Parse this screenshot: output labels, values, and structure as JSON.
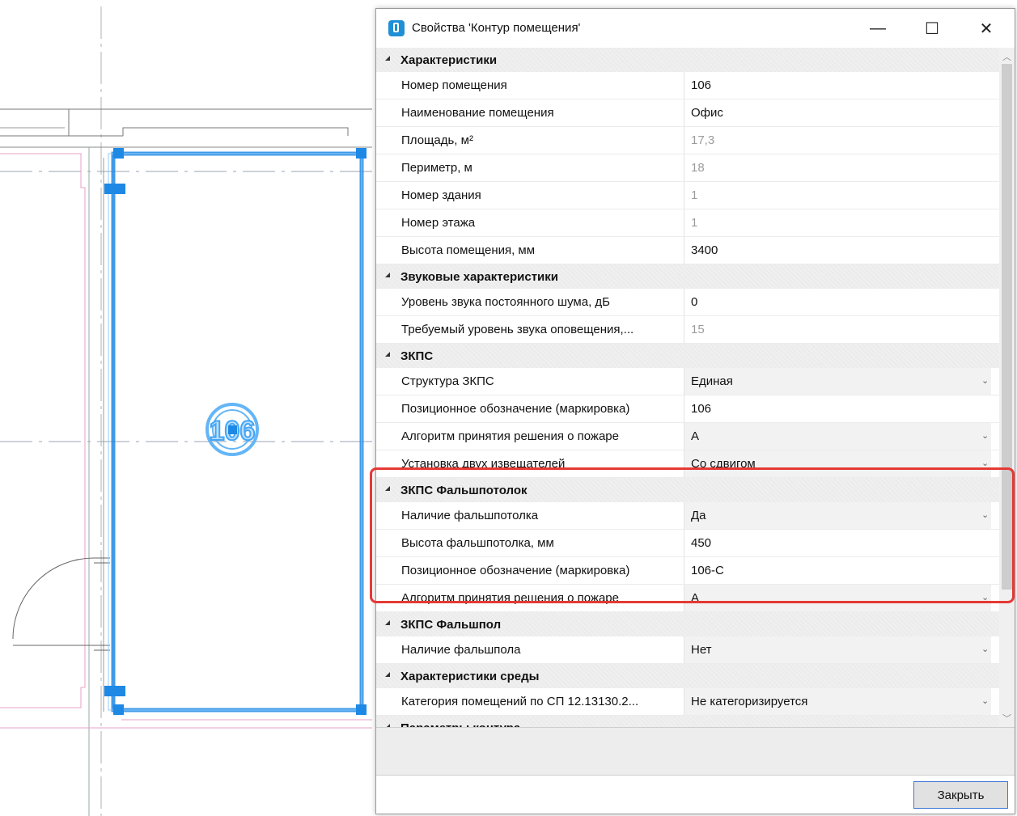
{
  "canvas": {
    "room_number_label": "106"
  },
  "dialog": {
    "title": "Свойства 'Контур помещения'",
    "window_controls": {
      "minimize": "—",
      "maximize": "☐",
      "close": "✕"
    },
    "categories": [
      {
        "label": "Характеристики",
        "properties": [
          {
            "name": "Номер помещения",
            "value": "106",
            "readonly": false,
            "dropdown": false
          },
          {
            "name": "Наименование помещения",
            "value": "Офис",
            "readonly": false,
            "dropdown": false
          },
          {
            "name": "Площадь, м²",
            "value": "17,3",
            "readonly": true,
            "dropdown": false
          },
          {
            "name": "Периметр, м",
            "value": "18",
            "readonly": true,
            "dropdown": false
          },
          {
            "name": "Номер здания",
            "value": "1",
            "readonly": true,
            "dropdown": false
          },
          {
            "name": "Номер этажа",
            "value": "1",
            "readonly": true,
            "dropdown": false
          },
          {
            "name": "Высота помещения, мм",
            "value": "3400",
            "readonly": false,
            "dropdown": false
          }
        ]
      },
      {
        "label": "Звуковые характеристики",
        "properties": [
          {
            "name": "Уровень звука постоянного шума, дБ",
            "value": "0",
            "readonly": false,
            "dropdown": false
          },
          {
            "name": "Требуемый уровень звука оповещения,...",
            "value": "15",
            "readonly": true,
            "dropdown": false
          }
        ]
      },
      {
        "label": "ЗКПС",
        "properties": [
          {
            "name": "Структура ЗКПС",
            "value": "Единая",
            "readonly": false,
            "dropdown": true
          },
          {
            "name": "Позиционное обозначение (маркировка)",
            "value": "106",
            "readonly": false,
            "dropdown": false
          },
          {
            "name": "Алгоритм принятия решения о пожаре",
            "value": "А",
            "readonly": false,
            "dropdown": true
          },
          {
            "name": "Установка двух извещателей",
            "value": "Со сдвигом",
            "readonly": false,
            "dropdown": true
          }
        ]
      },
      {
        "label": "ЗКПС Фальшпотолок",
        "properties": [
          {
            "name": "Наличие фальшпотолка",
            "value": "Да",
            "readonly": false,
            "dropdown": true
          },
          {
            "name": "Высота фальшпотолка, мм",
            "value": "450",
            "readonly": false,
            "dropdown": false
          },
          {
            "name": "Позиционное обозначение (маркировка)",
            "value": "106-С",
            "readonly": false,
            "dropdown": false
          },
          {
            "name": "Алгоритм принятия решения о пожаре",
            "value": "А",
            "readonly": false,
            "dropdown": true
          }
        ]
      },
      {
        "label": "ЗКПС Фальшпол",
        "properties": [
          {
            "name": "Наличие фальшпола",
            "value": "Нет",
            "readonly": false,
            "dropdown": true
          }
        ]
      },
      {
        "label": "Характеристики среды",
        "properties": [
          {
            "name": "Категория помещений по СП 12.13130.2...",
            "value": "Не категоризируется",
            "readonly": false,
            "dropdown": true
          }
        ]
      },
      {
        "label": "Параметры контура",
        "properties": []
      }
    ],
    "close_button": "Закрыть"
  },
  "colors": {
    "selection_blue": "#1e88e5",
    "highlight_red": "#e53935",
    "wall_pink": "#e7a0c8"
  }
}
